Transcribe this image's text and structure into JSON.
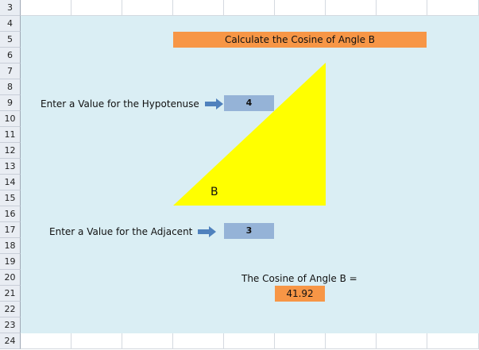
{
  "sheet": {
    "row_numbers": [
      "3",
      "4",
      "5",
      "6",
      "7",
      "8",
      "9",
      "10",
      "11",
      "12",
      "13",
      "14",
      "15",
      "16",
      "17",
      "18",
      "19",
      "20",
      "21",
      "22",
      "23",
      "24"
    ]
  },
  "content": {
    "title": "Calculate the Cosine of Angle B",
    "hypotenuse_label": "Enter a Value for the Hypotenuse",
    "hypotenuse_value": "4",
    "adjacent_label": "Enter a Value for the Adjacent",
    "adjacent_value": "3",
    "angle_label": "B",
    "result_label": "The Cosine of Angle B  =",
    "result_value": "41.92"
  },
  "colors": {
    "fill_area": "#daeef4",
    "title_bg": "#f79646",
    "input_bg": "#95b3d7",
    "triangle": "#ffff00",
    "arrow": "#4f81bd"
  }
}
